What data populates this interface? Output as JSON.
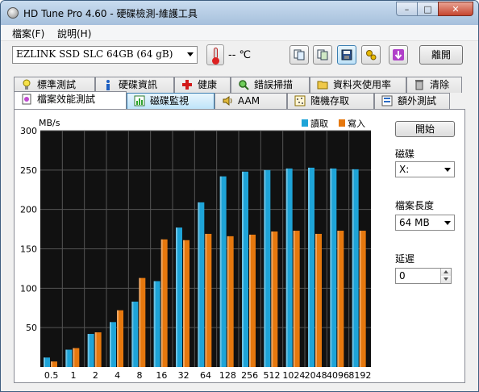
{
  "window": {
    "title": "HD Tune Pro 4.60 - 硬碟檢測-維護工具",
    "controls": {
      "minimize": "–",
      "maximize": "□",
      "close": "✕"
    }
  },
  "menu": {
    "file": "檔案(F)",
    "help": "說明(H)"
  },
  "toolbar": {
    "drive": "EZLINK  SSD SLC 64GB    (64 gB)",
    "temperature": "-- ℃",
    "exit": "離開"
  },
  "tabs_top": [
    {
      "label": "標準測試",
      "icon": "lightbulb-icon"
    },
    {
      "label": "硬碟資訊",
      "icon": "info-icon"
    },
    {
      "label": "健康",
      "icon": "health-cross-icon"
    },
    {
      "label": "錯誤掃描",
      "icon": "magnifier-icon"
    },
    {
      "label": "資料夾使用率",
      "icon": "folder-icon"
    },
    {
      "label": "清除",
      "icon": "trash-icon"
    }
  ],
  "tabs_bottom": [
    {
      "label": "檔案效能測試",
      "icon": "file-benchmark-icon"
    },
    {
      "label": "磁碟監視",
      "icon": "disk-monitor-icon"
    },
    {
      "label": "AAM",
      "icon": "speaker-icon"
    },
    {
      "label": "隨機存取",
      "icon": "random-access-icon"
    },
    {
      "label": "額外測試",
      "icon": "extra-tests-icon"
    }
  ],
  "side": {
    "start": "開始",
    "disk_label": "磁碟",
    "disk_value": "X:",
    "file_length_label": "檔案長度",
    "file_length_value": "64 MB",
    "delay_label": "延遲",
    "delay_value": "0"
  },
  "colors": {
    "read": "#1ea4d8",
    "write": "#e6780e",
    "chart_bg": "#111111",
    "grid": "#555555"
  },
  "chart_data": {
    "type": "bar",
    "ylabel": "MB/s",
    "ylim": [
      0,
      300
    ],
    "yticks": [
      50,
      100,
      150,
      200,
      250,
      300
    ],
    "grid": true,
    "legend_position": "top-right",
    "categories": [
      "0.5",
      "1",
      "2",
      "4",
      "8",
      "16",
      "32",
      "64",
      "128",
      "256",
      "512",
      "1024",
      "2048",
      "4096",
      "8192"
    ],
    "series": [
      {
        "name": "讀取",
        "color": "#1ea4d8",
        "values": [
          12,
          22,
          42,
          57,
          83,
          109,
          177,
          209,
          242,
          248,
          250,
          252,
          253,
          252,
          251
        ]
      },
      {
        "name": "寫入",
        "color": "#e6780e",
        "values": [
          7,
          24,
          44,
          72,
          113,
          162,
          161,
          169,
          166,
          168,
          172,
          173,
          169,
          173,
          173
        ]
      }
    ]
  }
}
